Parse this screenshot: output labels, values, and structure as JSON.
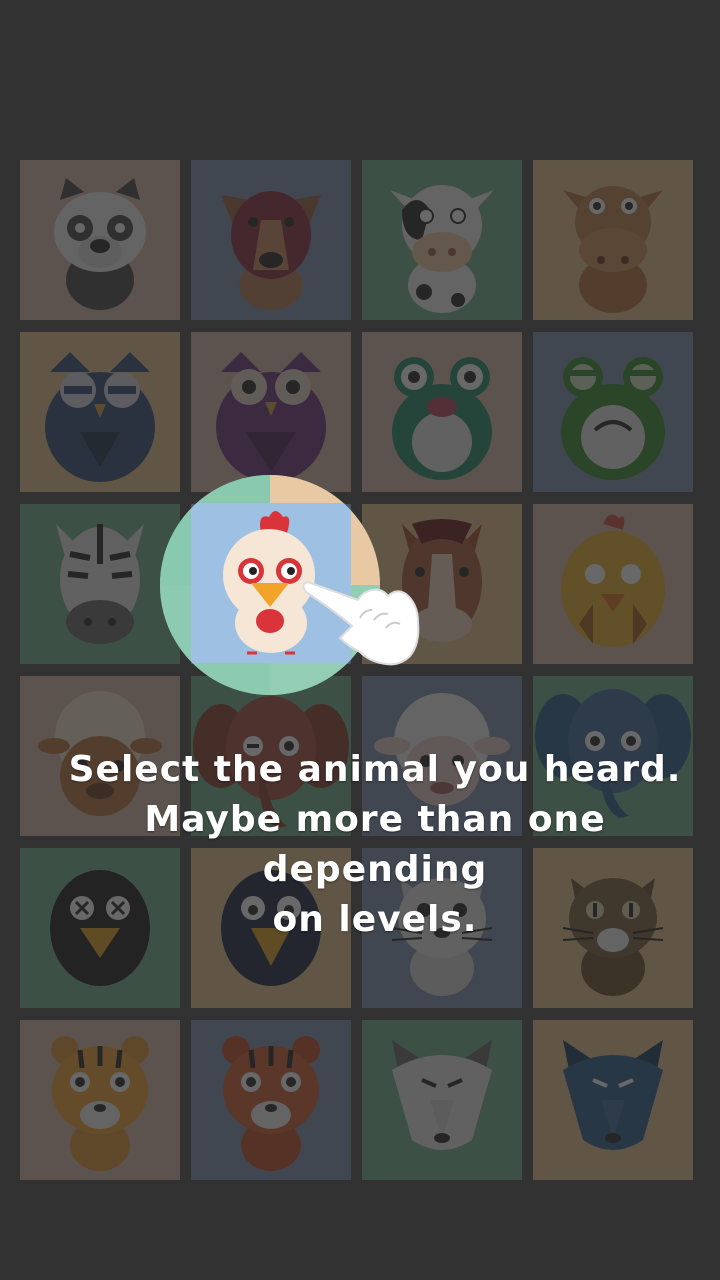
{
  "instruction": {
    "line1": "Select the animal you heard.",
    "line2": "Maybe more than one depending",
    "line3": "on levels."
  },
  "highlighted_tile": "rooster",
  "tiles": [
    {
      "animal": "panda-dog",
      "bg": "#d9b7a8"
    },
    {
      "animal": "dog",
      "bg": "#7d8fb3"
    },
    {
      "animal": "cow",
      "bg": "#6fb08a"
    },
    {
      "animal": "brown-cow",
      "bg": "#e6c38e"
    },
    {
      "animal": "owl-blue",
      "bg": "#e6c38e"
    },
    {
      "animal": "owl-purple",
      "bg": "#d9b7a8"
    },
    {
      "animal": "frog",
      "bg": "#d9b7a8"
    },
    {
      "animal": "green-frog",
      "bg": "#7d8fb3"
    },
    {
      "animal": "zebra",
      "bg": "#6fb08a"
    },
    {
      "animal": "rooster",
      "bg": "#a3c4e6"
    },
    {
      "animal": "horse",
      "bg": "#e6c38e"
    },
    {
      "animal": "chick",
      "bg": "#d9b7a8"
    },
    {
      "animal": "sheep-brown",
      "bg": "#d9b7a8"
    },
    {
      "animal": "elephant-brown",
      "bg": "#6fb08a"
    },
    {
      "animal": "sheep-white",
      "bg": "#7d8fb3"
    },
    {
      "animal": "elephant-blue",
      "bg": "#6fb08a"
    },
    {
      "animal": "crow-dead",
      "bg": "#6fb08a"
    },
    {
      "animal": "crow",
      "bg": "#e6c38e"
    },
    {
      "animal": "cat-grey",
      "bg": "#7d8fb3"
    },
    {
      "animal": "cat-brown",
      "bg": "#e6c38e"
    },
    {
      "animal": "tiger",
      "bg": "#d9b7a8"
    },
    {
      "animal": "tiger-red",
      "bg": "#7d8fb3"
    },
    {
      "animal": "wolf-grey",
      "bg": "#6fb08a"
    },
    {
      "animal": "wolf-blue",
      "bg": "#e6c38e"
    }
  ]
}
